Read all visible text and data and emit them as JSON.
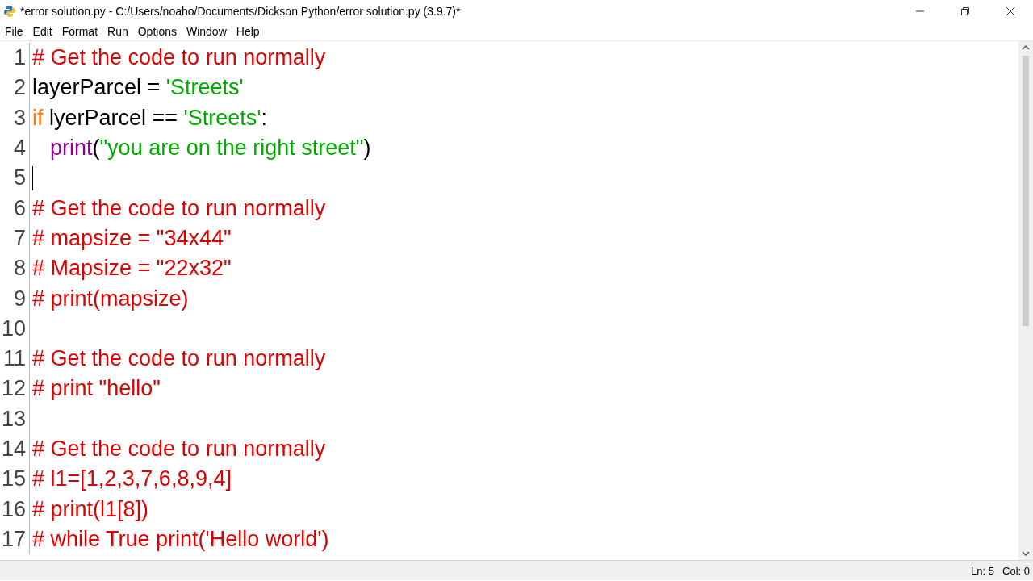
{
  "window": {
    "title": "*error solution.py - C:/Users/noaho/Documents/Dickson Python/error solution.py (3.9.7)*"
  },
  "menu": [
    "File",
    "Edit",
    "Format",
    "Run",
    "Options",
    "Window",
    "Help"
  ],
  "editor": {
    "lines": [
      {
        "number": "1",
        "caret": false,
        "tokens": [
          {
            "kind": "comment",
            "text": "# Get the code to run normally"
          }
        ]
      },
      {
        "number": "2",
        "caret": false,
        "tokens": [
          {
            "kind": "plain",
            "text": "layerParcel = "
          },
          {
            "kind": "string",
            "text": "'Streets'"
          }
        ]
      },
      {
        "number": "3",
        "caret": false,
        "tokens": [
          {
            "kind": "keyword",
            "text": "if"
          },
          {
            "kind": "plain",
            "text": " lyerParcel == "
          },
          {
            "kind": "string",
            "text": "'Streets'"
          },
          {
            "kind": "plain",
            "text": ":"
          }
        ]
      },
      {
        "number": "4",
        "caret": false,
        "indented": true,
        "tokens": [
          {
            "kind": "builtin",
            "text": "print"
          },
          {
            "kind": "plain",
            "text": "("
          },
          {
            "kind": "string",
            "text": "\"you are on the right street\""
          },
          {
            "kind": "plain",
            "text": ")"
          }
        ]
      },
      {
        "number": "5",
        "caret": true
      },
      {
        "number": "6",
        "caret": false,
        "tokens": [
          {
            "kind": "comment",
            "text": "# Get the code to run normally"
          }
        ]
      },
      {
        "number": "7",
        "caret": false,
        "tokens": [
          {
            "kind": "comment",
            "text": "# mapsize = \"34x44\""
          }
        ]
      },
      {
        "number": "8",
        "caret": false,
        "tokens": [
          {
            "kind": "comment",
            "text": "# Mapsize = \"22x32\""
          }
        ]
      },
      {
        "number": "9",
        "caret": false,
        "tokens": [
          {
            "kind": "comment",
            "text": "# print(mapsize)"
          }
        ]
      },
      {
        "number": "10",
        "caret": false
      },
      {
        "number": "11",
        "caret": false,
        "tokens": [
          {
            "kind": "comment",
            "text": "# Get the code to run normally"
          }
        ]
      },
      {
        "number": "12",
        "caret": false,
        "tokens": [
          {
            "kind": "comment",
            "text": "# print \"hello\""
          }
        ]
      },
      {
        "number": "13",
        "caret": false
      },
      {
        "number": "14",
        "caret": false,
        "tokens": [
          {
            "kind": "comment",
            "text": "# Get the code to run normally"
          }
        ]
      },
      {
        "number": "15",
        "caret": false,
        "tokens": [
          {
            "kind": "comment",
            "text": "# l1=[1,2,3,7,6,8,9,4]"
          }
        ]
      },
      {
        "number": "16",
        "caret": false,
        "tokens": [
          {
            "kind": "comment",
            "text": "# print(l1[8])"
          }
        ]
      },
      {
        "number": "17",
        "caret": false,
        "tokens": [
          {
            "kind": "comment",
            "text": "# while True print('Hello world')"
          }
        ]
      }
    ]
  },
  "status_bar": {
    "line": "Ln: 5",
    "column": "Col: 0"
  }
}
